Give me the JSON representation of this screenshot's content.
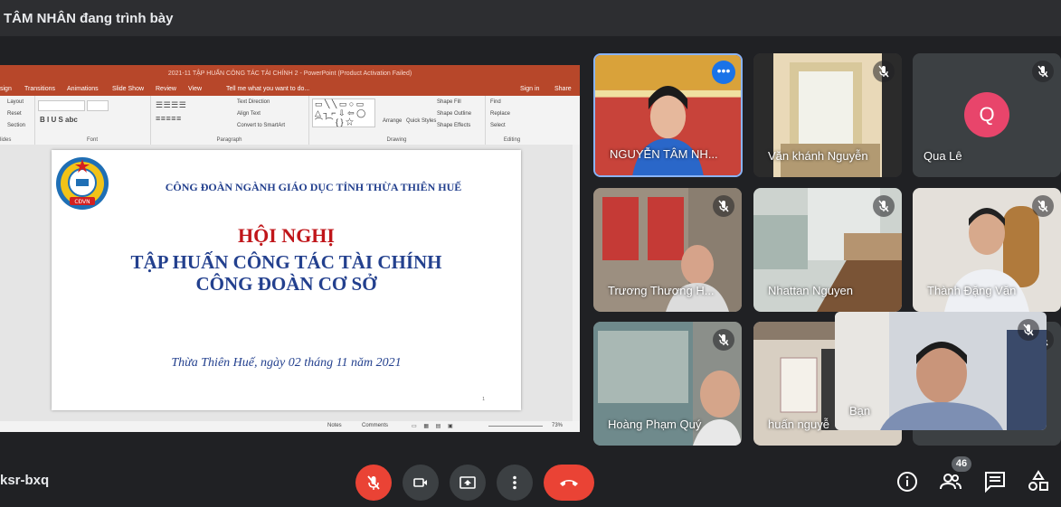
{
  "header": {
    "presenting_text": "TÂM NHÂN đang trình bày"
  },
  "presentation": {
    "window_title": "2021-11 TẬP HUẤN CÔNG TÁC TÀI CHÍNH 2 - PowerPoint (Product Activation Failed)",
    "tabs": [
      "sign",
      "Transitions",
      "Animations",
      "Slide Show",
      "Review",
      "View",
      "Tell me what you want to do...",
      "Sign in",
      "Share"
    ],
    "ribbon": {
      "slides_items": [
        "Layout",
        "Reset",
        "Section"
      ],
      "slides_label": "lides",
      "font_label": "Font",
      "paragraph_items": [
        "Text Direction",
        "Align Text",
        "Convert to SmartArt"
      ],
      "paragraph_label": "Paragraph",
      "drawing_items": [
        "Arrange",
        "Quick Styles",
        "Shape Fill",
        "Shape Outline",
        "Shape Effects"
      ],
      "drawing_label": "Drawing",
      "editing_items": [
        "Find",
        "Replace",
        "Select"
      ],
      "editing_label": "Editing"
    },
    "slide": {
      "org": "CÔNG ĐOÀN NGÀNH GIÁO DỤC TỈNH THỪA THIÊN HUẾ",
      "title": "HỘI NGHỊ",
      "subtitle_1": "TẬP HUẤN CÔNG TÁC TÀI CHÍNH",
      "subtitle_2": "CÔNG ĐOÀN CƠ SỞ",
      "date": "Thừa Thiên Huế, ngày 02 tháng 11 năm 2021",
      "page_number": "1",
      "logo_text": "CĐVN"
    },
    "status": {
      "notes": "Notes",
      "comments": "Comments",
      "zoom": "73%"
    }
  },
  "participants": [
    {
      "name": "NGUYỄN TÂM NH...",
      "muted": false
    },
    {
      "name": "Văn khánh Nguyễn",
      "muted": true
    },
    {
      "name": "Qua Lê",
      "muted": true,
      "avatar_letter": "Q"
    },
    {
      "name": "Trương Thương H...",
      "muted": true
    },
    {
      "name": "Nhattan Nguyen",
      "muted": true
    },
    {
      "name": "Thành Đặng Văn",
      "muted": true
    },
    {
      "name": "Hoàng Phạm Quý",
      "muted": true
    },
    {
      "name": "huấn nguyễ",
      "muted": false
    },
    {
      "name": "Bạn",
      "muted": true
    }
  ],
  "bottom": {
    "meeting_code": "ksr-bxq",
    "participant_count": "46"
  },
  "colors": {
    "background": "#202124",
    "end_call": "#ea4335",
    "mic_off": "#ea4335",
    "avatar": "#e8456b"
  }
}
